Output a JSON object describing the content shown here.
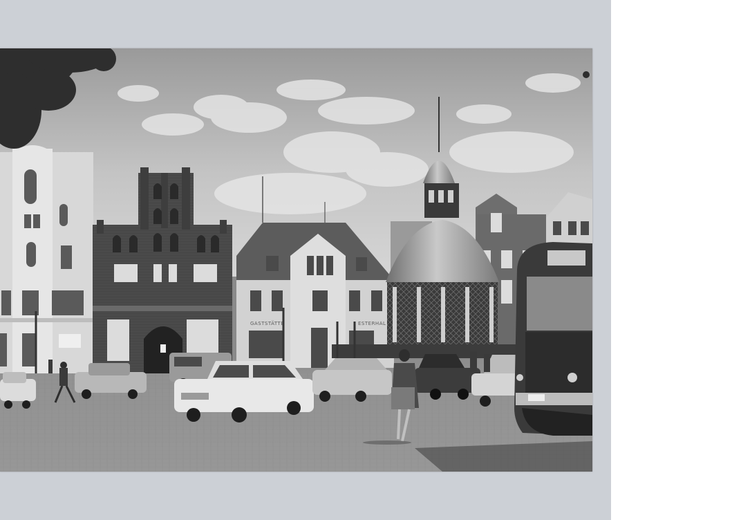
{
  "image": {
    "kind": "black-and-white postcard photograph",
    "subject": "town market square with a domed well pavilion, old brick gothic gable house, parked cars and a bus"
  },
  "signs": {
    "left": "GASTSTÄTTE",
    "right": "ESTERHAL"
  },
  "colors": {
    "backdrop": "#ccd0d6",
    "page": "#ffffff"
  }
}
